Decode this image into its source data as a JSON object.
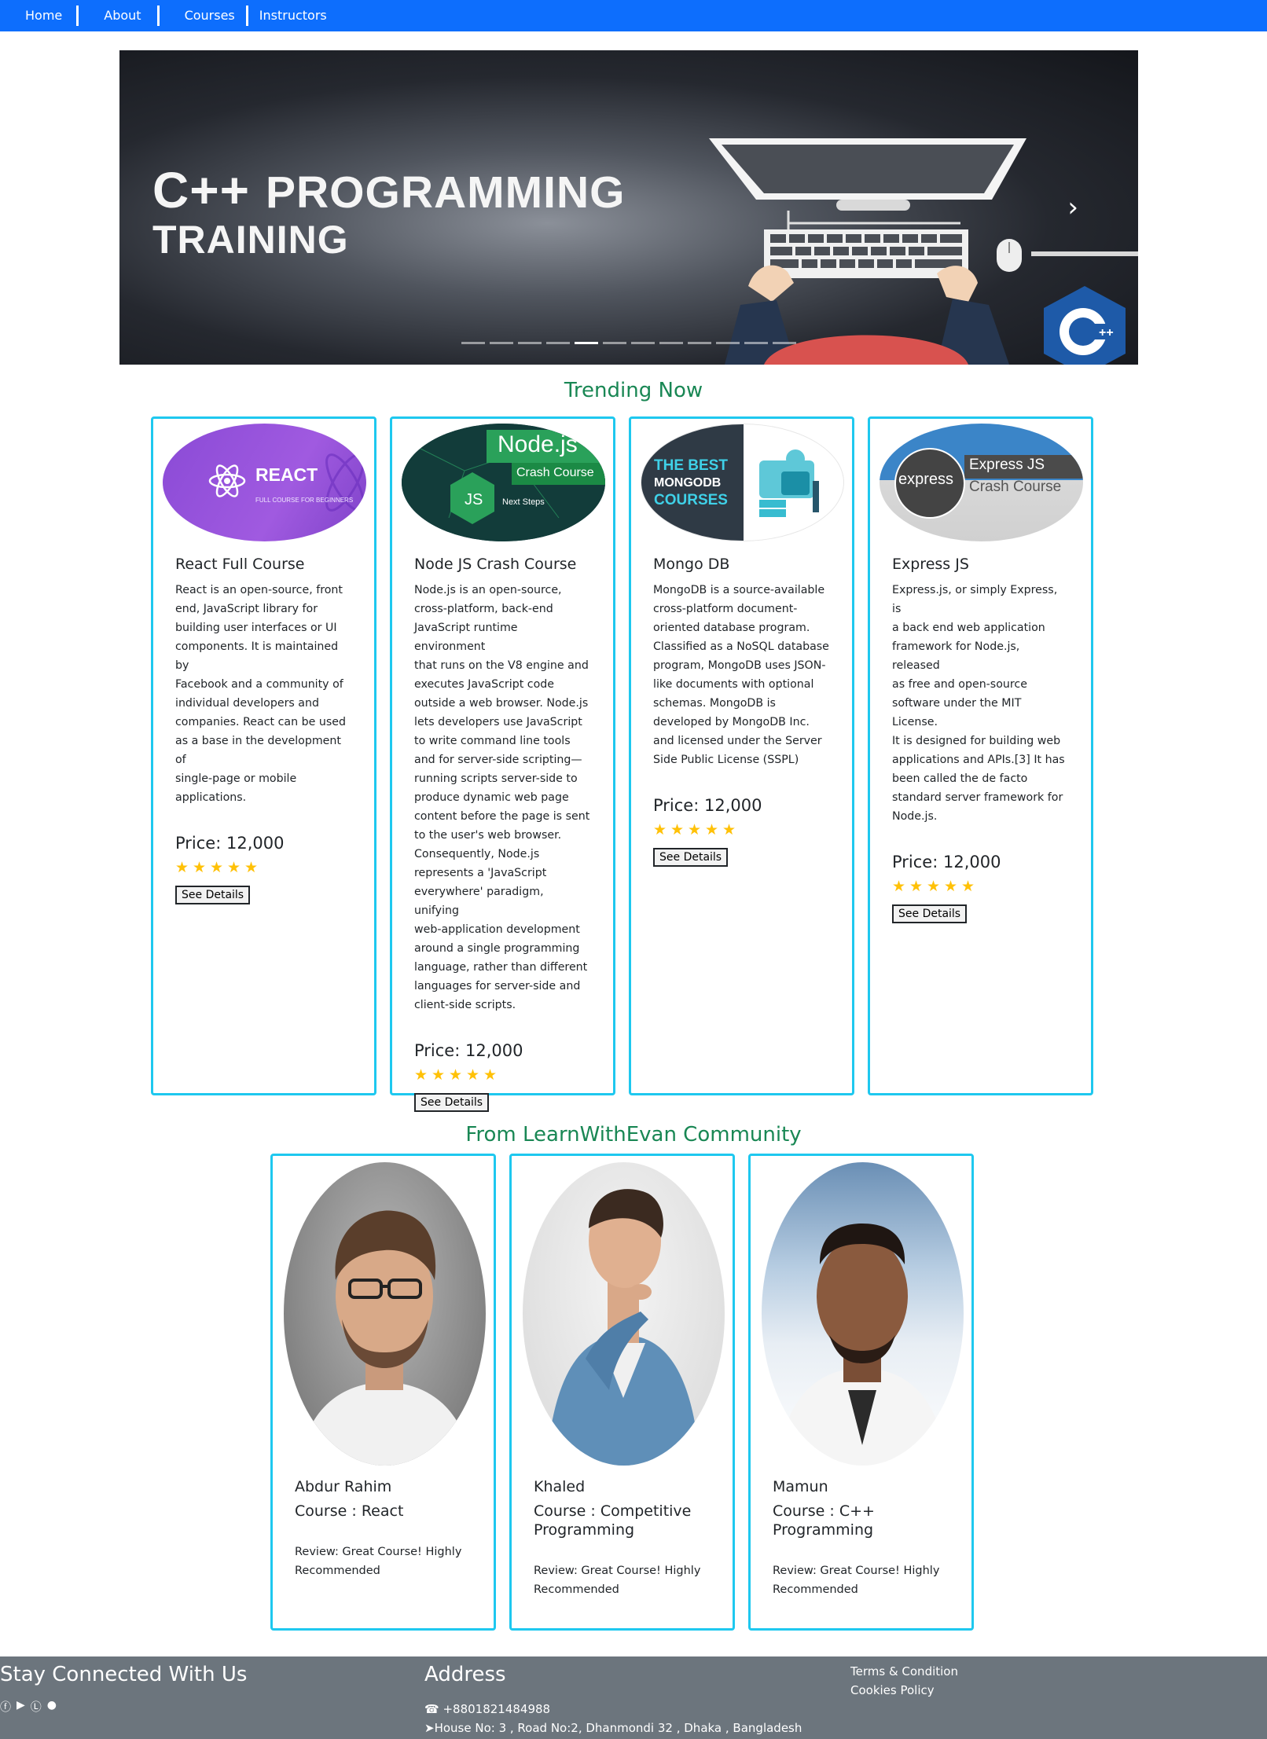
{
  "nav": {
    "items": [
      "Home",
      "About",
      "Courses",
      "Instructors"
    ]
  },
  "hero": {
    "line1_big": "C++",
    "line1_rest": "PROGRAMMING",
    "line2": "TRAINING",
    "next_icon": "chevron-right-icon",
    "indicator_count": 12,
    "active_indicator": 4
  },
  "trending": {
    "title": "Trending Now",
    "courses": [
      {
        "image_label": "REACT",
        "image_sub": "FULL COURSE FOR BEGINNERS",
        "name": "React Full Course",
        "description": [
          "React is an open-source, front",
          "end, JavaScript library for",
          "building user interfaces or UI",
          "components. It is maintained by",
          "Facebook and a community of",
          "individual developers and",
          "companies. React can be used",
          "as a base in the development of",
          "single-page or mobile",
          "applications."
        ],
        "price": "Price: 12,000",
        "rating": 5,
        "button": "See Details"
      },
      {
        "image_label": "Node.js",
        "image_sub": "Crash Course",
        "image_extra": "Next Steps",
        "image_badge": "JS",
        "name": "Node JS Crash Course",
        "description": [
          "Node.js is an open-source,",
          "cross-platform, back-end",
          "JavaScript runtime environment",
          "that runs on the V8 engine and",
          "executes JavaScript code",
          "outside a web browser. Node.js",
          "lets developers use JavaScript",
          "to write command line tools",
          "and for server-side scripting—",
          "running scripts server-side to",
          "produce dynamic web page",
          "content before the page is sent",
          "to the user's web browser.",
          "Consequently, Node.js",
          "represents a 'JavaScript",
          "everywhere' paradigm, unifying",
          "web-application development",
          "around a single programming",
          "language, rather than different",
          "languages for server-side and",
          "client-side scripts."
        ],
        "price": "Price: 12,000",
        "rating": 5,
        "button": "See Details"
      },
      {
        "image_label": "THE BEST",
        "image_sub": "MONGODB",
        "image_extra": "COURSES",
        "name": "Mongo DB",
        "description": [
          "MongoDB is a source-available",
          "cross-platform document-",
          "oriented database program.",
          "Classified as a NoSQL database",
          "program, MongoDB uses JSON-",
          "like documents with optional",
          "schemas. MongoDB is",
          "developed by MongoDB Inc.",
          "and licensed under the Server",
          "Side Public License (SSPL)"
        ],
        "price": "Price: 12,000",
        "rating": 5,
        "button": "See Details"
      },
      {
        "image_label": "Express JS",
        "image_sub": "Crash Course",
        "image_badge": "express",
        "name": "Express JS",
        "description": [
          "Express.js, or simply Express, is",
          "a back end web application",
          "framework for Node.js, released",
          "as free and open-source",
          "software under the MIT License.",
          "It is designed for building web",
          "applications and APIs.[3] It has",
          "been called the de facto",
          "standard server framework for",
          "Node.js."
        ],
        "price": "Price: 12,000",
        "rating": 5,
        "button": "See Details"
      }
    ]
  },
  "community": {
    "title": "From LearnWithEvan Community",
    "instructors": [
      {
        "name": "Abdur Rahim",
        "course": [
          "Course : React"
        ],
        "review": [
          "Review: Great Course! Highly",
          "Recommended"
        ]
      },
      {
        "name": "Khaled",
        "course": [
          "Course : Competitive",
          "Programming"
        ],
        "review": [
          "Review: Great Course! Highly",
          "Recommended"
        ]
      },
      {
        "name": "Mamun",
        "course": [
          "Course : C++",
          "Programming"
        ],
        "review": [
          "Review: Great Course! Highly",
          "Recommended"
        ]
      }
    ]
  },
  "footer": {
    "connect_title": "Stay Connected With Us",
    "social_icons": [
      "facebook-icon",
      "youtube-icon",
      "linkedin-icon",
      "github-icon"
    ],
    "address_title": "Address",
    "phone": "+8801821484988",
    "address": "House No: 3 , Road No:2, Dhanmondi 32 , Dhaka , Bangladesh",
    "links": [
      "Terms & Condition",
      "Cookies Policy"
    ]
  },
  "colors": {
    "navbar": "#0d6efd",
    "section_title": "#198754",
    "card_border": "#1ec8ef",
    "star": "#ffc107",
    "footer": "#6c757d"
  }
}
